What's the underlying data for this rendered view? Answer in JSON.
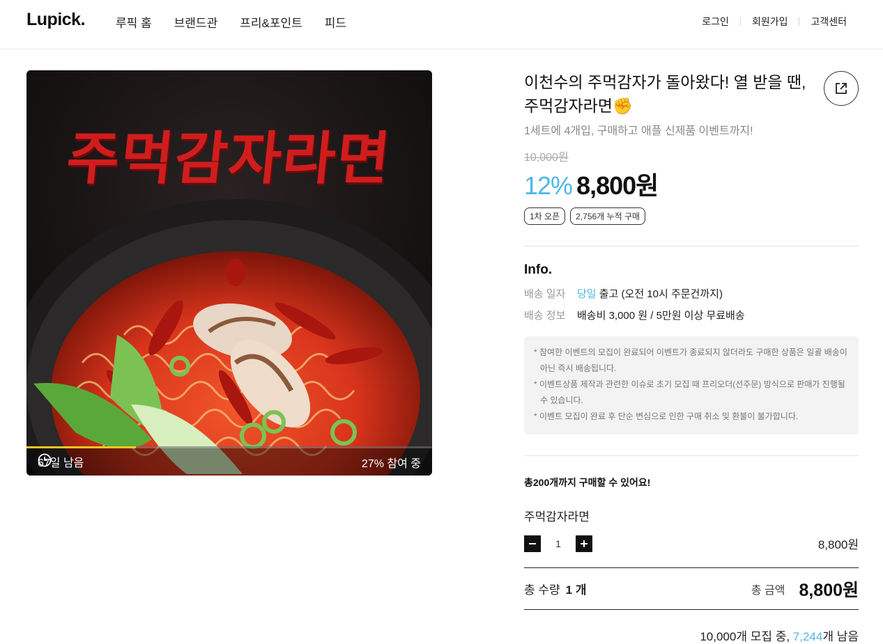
{
  "header": {
    "logo": "Lupick.",
    "nav": [
      "루픽 홈",
      "브랜드관",
      "프리&포인트",
      "피드"
    ],
    "util": [
      "로그인",
      "회원가입",
      "고객센터"
    ]
  },
  "hero": {
    "title_text": "주먹감자라면",
    "days_left": "67일 남음",
    "participation": "27% 참여 중",
    "progress_fraction": 0.27
  },
  "product": {
    "title": "이천수의 주먹감자가 돌아왔다! 열 받을 땐, 주먹감자라면✊",
    "subtitle": "1세트에 4개입, 구매하고 애플 신제품 이벤트까지!",
    "original_price": "10,000원",
    "discount": "12%",
    "price": "8,800원",
    "tags": [
      "1차 오픈",
      "2,756개 누적 구매"
    ]
  },
  "info": {
    "heading": "Info.",
    "rows": [
      {
        "label": "배송 일자",
        "highlight": "당일",
        "value": " 출고 (오전 10시 주문건까지)"
      },
      {
        "label": "배송 정보",
        "highlight": "",
        "value": "배송비 3,000 원 / 5만원 이상 무료배송"
      }
    ],
    "notices": [
      "* 참여한 이벤트의 모집이 완료되어 이벤트가 종료되지 않더라도 구매한 상품은 일괄 배송이 아닌 즉시 배송됩니다.",
      "* 이벤트상품 제작과 관련한 이슈로 초기 모집 때 프리오더(선주문) 방식으로 판매가 진행될 수 있습니다.",
      "* 이벤트 모집이 완료 후 단순 변심으로 인한 구매 취소 및 환불이 불가합니다."
    ]
  },
  "purchase": {
    "limit_text": "총200개까지 구매할 수 있어요!",
    "option_name": "주먹감자라면",
    "quantity": "1",
    "option_price": "8,800원",
    "total_qty_label": "총 수량",
    "total_qty": "1 개",
    "total_amount_label": "총 금액",
    "total_amount": "8,800원",
    "recruit_prefix": "10,000개 모집 중, ",
    "recruit_remaining": "7,244",
    "recruit_suffix": "개 남음"
  },
  "colors": {
    "accent": "#4fb5ea",
    "progress": "#f3c61f",
    "hero_title": "#cf1d1d"
  }
}
